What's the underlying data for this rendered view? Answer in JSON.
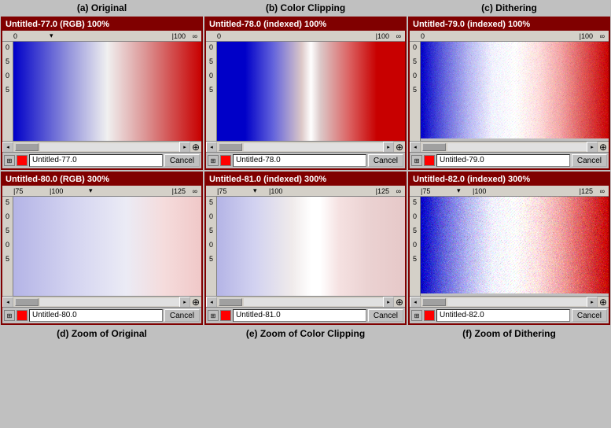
{
  "titles": {
    "a": "(a) Original",
    "b": "(b) Color Clipping",
    "c": "(c) Dithering",
    "d": "(d) Zoom of Original",
    "e": "(e) Zoom of Color Clipping",
    "f": "(f) Zoom of Dithering"
  },
  "panels": {
    "top_left": {
      "title": "Untitled-77.0 (RGB) 100%",
      "filename": "Untitled-77.0",
      "cancel": "Cancel"
    },
    "top_mid": {
      "title": "Untitled-78.0 (indexed) 100%",
      "filename": "Untitled-78.0",
      "cancel": "Cancel"
    },
    "top_right": {
      "title": "Untitled-79.0 (indexed) 100%",
      "filename": "Untitled-79.0",
      "cancel": "Cancel"
    },
    "bot_left": {
      "title": "Untitled-80.0 (RGB) 300%",
      "filename": "Untitled-80.0",
      "cancel": "Cancel"
    },
    "bot_mid": {
      "title": "Untitled-81.0 (indexed) 300%",
      "filename": "Untitled-81.0",
      "cancel": "Cancel"
    },
    "bot_right": {
      "title": "Untitled-82.0 (indexed) 300%",
      "filename": "Untitled-82.0",
      "cancel": "Cancel"
    }
  },
  "ruler": {
    "top_marks": [
      "0",
      "|100"
    ],
    "left_marks": [
      "0",
      "5",
      "0",
      "5"
    ]
  }
}
